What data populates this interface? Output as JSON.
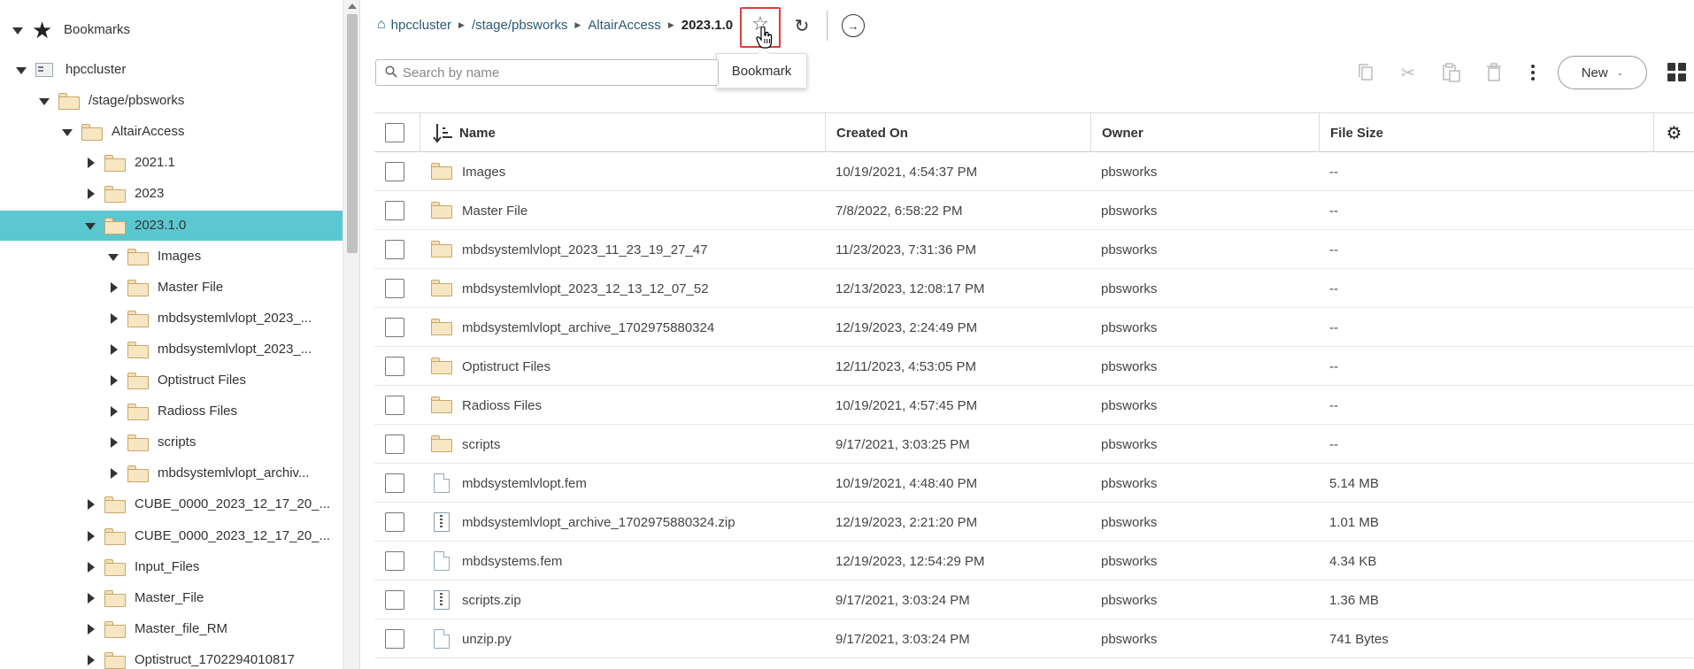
{
  "sidebar": {
    "bookmarks_label": "Bookmarks",
    "tree": [
      {
        "label": "hpccluster",
        "caret": "down",
        "icon": "server-icon",
        "indent": 0
      },
      {
        "label": "/stage/pbsworks",
        "caret": "down",
        "icon": "folder-icon",
        "indent": 1
      },
      {
        "label": "AltairAccess",
        "caret": "down",
        "icon": "folder-icon",
        "indent": 2
      },
      {
        "label": "2021.1",
        "caret": "right",
        "icon": "folder-icon",
        "indent": 3
      },
      {
        "label": "2023",
        "caret": "right",
        "icon": "folder-icon",
        "indent": 3
      },
      {
        "label": "2023.1.0",
        "caret": "down",
        "icon": "folder-icon",
        "indent": 3,
        "selected": true
      },
      {
        "label": "Images",
        "caret": "down",
        "icon": "folder-icon",
        "indent": 4
      },
      {
        "label": "Master File",
        "caret": "right",
        "icon": "folder-icon",
        "indent": 4
      },
      {
        "label": "mbdsystemlvlopt_2023_...",
        "caret": "right",
        "icon": "folder-icon",
        "indent": 4
      },
      {
        "label": "mbdsystemlvlopt_2023_...",
        "caret": "right",
        "icon": "folder-icon",
        "indent": 4
      },
      {
        "label": "Optistruct Files",
        "caret": "right",
        "icon": "folder-icon",
        "indent": 4
      },
      {
        "label": "Radioss Files",
        "caret": "right",
        "icon": "folder-icon",
        "indent": 4
      },
      {
        "label": "scripts",
        "caret": "right",
        "icon": "folder-icon",
        "indent": 4
      },
      {
        "label": "mbdsystemlvlopt_archiv...",
        "caret": "right",
        "icon": "folder-icon",
        "indent": 4
      },
      {
        "label": "CUBE_0000_2023_12_17_20_...",
        "caret": "right",
        "icon": "folder-icon",
        "indent": 3
      },
      {
        "label": "CUBE_0000_2023_12_17_20_...",
        "caret": "right",
        "icon": "folder-icon",
        "indent": 3
      },
      {
        "label": "Input_Files",
        "caret": "right",
        "icon": "folder-icon",
        "indent": 3
      },
      {
        "label": "Master_File",
        "caret": "right",
        "icon": "folder-icon",
        "indent": 3
      },
      {
        "label": "Master_file_RM",
        "caret": "right",
        "icon": "folder-icon",
        "indent": 3
      },
      {
        "label": "Optistruct_1702294010817",
        "caret": "right",
        "icon": "folder-icon",
        "indent": 3
      }
    ]
  },
  "breadcrumb": {
    "items": [
      "hpccluster",
      "/stage/pbsworks",
      "AltairAccess"
    ],
    "current": "2023.1.0"
  },
  "tooltip": {
    "text": "Bookmark"
  },
  "search": {
    "placeholder": "Search by name",
    "value": ""
  },
  "toolbar": {
    "new_label": "New"
  },
  "table": {
    "headers": {
      "name": "Name",
      "created": "Created On",
      "owner": "Owner",
      "size": "File Size"
    },
    "rows": [
      {
        "type": "folder",
        "name": "Images",
        "created": "10/19/2021, 4:54:37 PM",
        "owner": "pbsworks",
        "size": "--"
      },
      {
        "type": "folder",
        "name": "Master File",
        "created": "7/8/2022, 6:58:22 PM",
        "owner": "pbsworks",
        "size": "--"
      },
      {
        "type": "folder",
        "name": "mbdsystemlvlopt_2023_11_23_19_27_47",
        "created": "11/23/2023, 7:31:36 PM",
        "owner": "pbsworks",
        "size": "--"
      },
      {
        "type": "folder",
        "name": "mbdsystemlvlopt_2023_12_13_12_07_52",
        "created": "12/13/2023, 12:08:17 PM",
        "owner": "pbsworks",
        "size": "--"
      },
      {
        "type": "folder",
        "name": "mbdsystemlvlopt_archive_1702975880324",
        "created": "12/19/2023, 2:24:49 PM",
        "owner": "pbsworks",
        "size": "--"
      },
      {
        "type": "folder",
        "name": "Optistruct Files",
        "created": "12/11/2023, 4:53:05 PM",
        "owner": "pbsworks",
        "size": "--"
      },
      {
        "type": "folder",
        "name": "Radioss Files",
        "created": "10/19/2021, 4:57:45 PM",
        "owner": "pbsworks",
        "size": "--"
      },
      {
        "type": "folder",
        "name": "scripts",
        "created": "9/17/2021, 3:03:25 PM",
        "owner": "pbsworks",
        "size": "--"
      },
      {
        "type": "file",
        "name": "mbdsystemlvlopt.fem",
        "created": "10/19/2021, 4:48:40 PM",
        "owner": "pbsworks",
        "size": "5.14 MB"
      },
      {
        "type": "zip",
        "name": "mbdsystemlvlopt_archive_1702975880324.zip",
        "created": "12/19/2023, 2:21:20 PM",
        "owner": "pbsworks",
        "size": "1.01 MB"
      },
      {
        "type": "file",
        "name": "mbdsystems.fem",
        "created": "12/19/2023, 12:54:29 PM",
        "owner": "pbsworks",
        "size": "4.34 KB"
      },
      {
        "type": "zip",
        "name": "scripts.zip",
        "created": "9/17/2021, 3:03:24 PM",
        "owner": "pbsworks",
        "size": "1.36 MB"
      },
      {
        "type": "file",
        "name": "unzip.py",
        "created": "9/17/2021, 3:03:24 PM",
        "owner": "pbsworks",
        "size": "741 Bytes"
      }
    ]
  },
  "colors": {
    "selected_row": "#5bc8d0",
    "bookmark_highlight": "#e03c3c",
    "breadcrumb_link": "#2c5a76"
  }
}
